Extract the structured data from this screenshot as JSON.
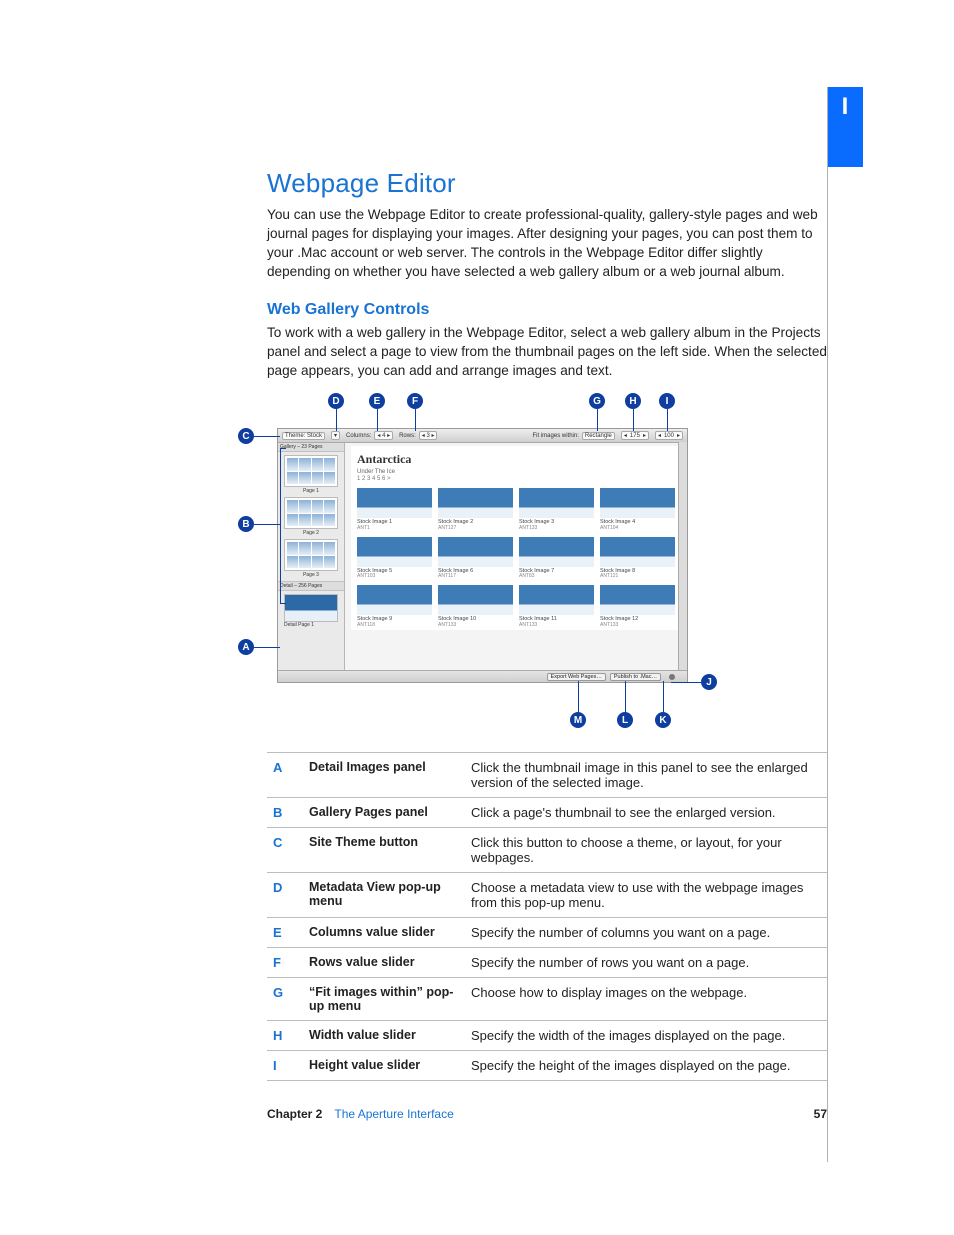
{
  "sideTab": "I",
  "heading": "Webpage Editor",
  "intro": "You can use the Webpage Editor to create professional-quality, gallery-style pages and web journal pages for displaying your images. After designing your pages, you can post them to your .Mac account or web server. The controls in the Webpage Editor differ slightly depending on whether you have selected a web gallery album or a web journal album.",
  "subheading": "Web Gallery Controls",
  "subintro": "To work with a web gallery in the Webpage Editor, select a web gallery album in the Projects panel and select a page to view from the thumbnail pages on the left side. When the selected page appears, you can add and arrange images and text.",
  "editor": {
    "toolbar": {
      "themeLabel": "Theme: Stock",
      "columnsLabel": "Columns:",
      "columnsValue": "4",
      "rowsLabel": "Rows:",
      "rowsValue": "3",
      "fitLabel": "Fit images within:",
      "fitValue": "Rectangle",
      "widthValue": "175",
      "heightValue": "100"
    },
    "leftPane": {
      "galleryHeader": "Gallery – 23 Pages",
      "pages": [
        "Page 1",
        "Page 2",
        "Page 3"
      ],
      "detailHeader": "Detail – 256 Pages",
      "detailPage": "Detail Page 1"
    },
    "canvas": {
      "title": "Antarctica",
      "subtitle": "Under The Ice",
      "pager": "1  2  3  4  5  6 >",
      "images": [
        {
          "cap": "Stock Image 1",
          "code": "ANT1"
        },
        {
          "cap": "Stock Image 2",
          "code": "ANT127"
        },
        {
          "cap": "Stock Image 3",
          "code": "ANT133"
        },
        {
          "cap": "Stock Image 4",
          "code": "ANT104"
        },
        {
          "cap": "Stock Image 5",
          "code": "ANT103"
        },
        {
          "cap": "Stock Image 6",
          "code": "ANT117"
        },
        {
          "cap": "Stock Image 7",
          "code": "ANT83"
        },
        {
          "cap": "Stock Image 8",
          "code": "ANT121"
        },
        {
          "cap": "Stock Image 9",
          "code": "ANT118"
        },
        {
          "cap": "Stock Image 10",
          "code": "ANT133"
        },
        {
          "cap": "Stock Image 11",
          "code": "ANT133"
        },
        {
          "cap": "Stock Image 12",
          "code": "ANT133"
        }
      ]
    },
    "footer": {
      "exportLabel": "Export Web Pages…",
      "publishLabel": "Publish to .Mac…"
    }
  },
  "calloutsTop": [
    "D",
    "E",
    "F",
    "G",
    "H",
    "I"
  ],
  "calloutsLeft": [
    "C",
    "B",
    "A"
  ],
  "calloutsRight": [
    "J"
  ],
  "calloutsBottom": [
    "M",
    "L",
    "K"
  ],
  "table": [
    {
      "l": "A",
      "n": "Detail Images panel",
      "d": "Click the thumbnail image in this panel to see the enlarged version of the selected image."
    },
    {
      "l": "B",
      "n": "Gallery Pages panel",
      "d": "Click a page's thumbnail to see the enlarged version."
    },
    {
      "l": "C",
      "n": "Site Theme button",
      "d": "Click this button to choose a theme, or layout, for your webpages."
    },
    {
      "l": "D",
      "n": "Metadata View pop-up menu",
      "d": "Choose a metadata view to use with the webpage images from this pop-up menu."
    },
    {
      "l": "E",
      "n": "Columns value slider",
      "d": "Specify the number of columns you want on a page."
    },
    {
      "l": "F",
      "n": "Rows value slider",
      "d": "Specify the number of rows you want on a page."
    },
    {
      "l": "G",
      "n": "“Fit images within” pop-up menu",
      "d": "Choose how to display images on the webpage."
    },
    {
      "l": "H",
      "n": "Width value slider",
      "d": "Specify the width of the images displayed on the page."
    },
    {
      "l": "I",
      "n": "Height value slider",
      "d": "Specify the height of the images displayed on the page."
    }
  ],
  "footer": {
    "chapter": "Chapter 2",
    "title": "The Aperture Interface",
    "page": "57"
  }
}
